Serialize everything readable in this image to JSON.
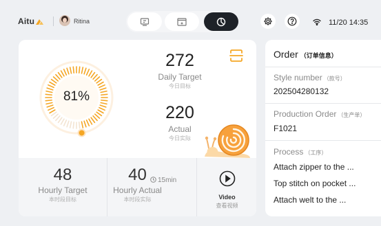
{
  "header": {
    "brand": "Aitu",
    "user_name": "Ritina",
    "datetime": "11/20 14:35",
    "segments": [
      {
        "icon": "device-icon"
      },
      {
        "icon": "screen-icon"
      },
      {
        "icon": "pie-chart-icon",
        "active": true
      }
    ],
    "icons": [
      "gear-icon",
      "help-icon",
      "wifi-icon"
    ]
  },
  "progress": {
    "percent_label": "81%",
    "value": 0.81
  },
  "daily": {
    "target_value": "272",
    "target_label": "Daily Target",
    "target_sub": "今日目标",
    "actual_value": "220",
    "actual_label": "Actual",
    "actual_sub": "今日实际"
  },
  "hourly": {
    "target_value": "48",
    "target_label": "Hourly Target",
    "target_sub": "本时段目标",
    "actual_value": "40",
    "timer": "15min",
    "actual_label": "Hourly Actual",
    "actual_sub": "本时段实际"
  },
  "video": {
    "label": "Video",
    "sub": "查看视频"
  },
  "order": {
    "title": "Order",
    "title_cn": "（订单信息）",
    "style_label": "Style number",
    "style_label_cn": "（款号）",
    "style_value": "202504280132",
    "production_label": "Production Order",
    "production_label_cn": "（生产单）",
    "production_value": "F1021",
    "process_label": "Process",
    "process_label_cn": "（工序）",
    "processes": [
      "Attach zipper to the ...",
      "Top stitch on pocket ...",
      "Attach welt to the ..."
    ]
  },
  "colors": {
    "accent": "#f5a623",
    "dark": "#1e2228"
  }
}
